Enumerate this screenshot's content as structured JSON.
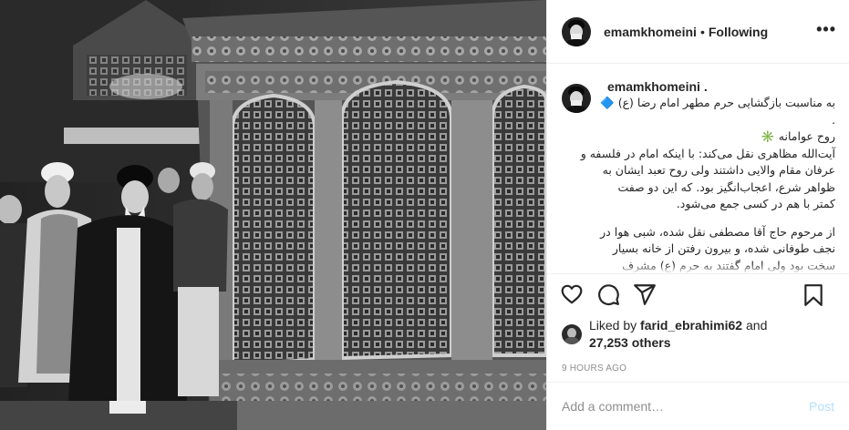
{
  "header": {
    "username": "emamkhomeini",
    "separator": "•",
    "follow_state": "Following",
    "more_icon": "•••"
  },
  "caption": {
    "username": "emamkhomeini .",
    "lines": [
      "به مناسبت بازگشایی حرم مطهر امام رضا (ع) 🔷",
      ".",
      "روح عوامانه ✳️",
      "آیت‌الله مظاهری نقل می‌کند: با اینکه امام در فلسفه و",
      "عرفان مقام والایی داشتند ولی روح تعبد ایشان به",
      "ظواهر شرع، اعجاب‌انگیز بود. که این دو صفت",
      "کمتر با هم در کسی جمع می‌شود.",
      "",
      "از مرحوم حاج آقا مصطفی نقل شده، شبی هوا در",
      "نجف طوفانی شده، و بیرون رفتن از خانه بسیار",
      "سخت بود ولی امام گفتند به حرم (ع) مشرف"
    ]
  },
  "actions": {
    "like_icon": "heart-icon",
    "comment_icon": "comment-icon",
    "share_icon": "share-icon",
    "save_icon": "bookmark-icon"
  },
  "likes": {
    "prefix": "Liked by",
    "user": "farid_ebrahimi62",
    "and": "and",
    "count": "27,253 others"
  },
  "timestamp": "9 HOURS AGO",
  "comment_box": {
    "placeholder": "Add a comment…",
    "post_label": "Post"
  },
  "colors": {
    "post_button_disabled": "#b2dffc",
    "text": "#262626",
    "muted": "#8e8e8e",
    "divider": "#efefef"
  }
}
